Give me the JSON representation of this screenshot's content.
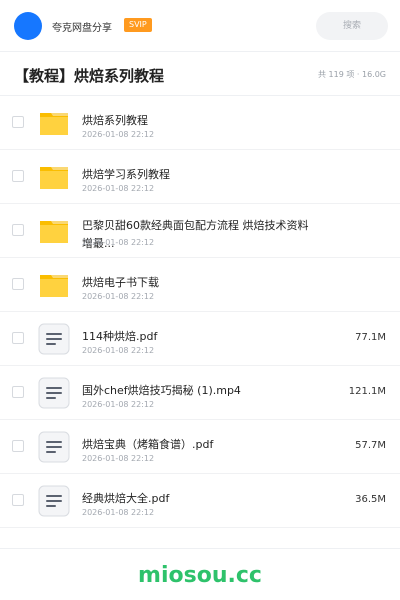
{
  "header": {
    "app_name": "夸克网盘分享",
    "badge": "SVIP",
    "search_placeholder": "搜索"
  },
  "folder": {
    "title": "【教程】烘焙系列教程",
    "stats": "共 119 项 · 16.0G"
  },
  "files": [
    {
      "type": "folder",
      "name": "烘焙系列教程",
      "date": "2026-01-08 22:12",
      "size": ""
    },
    {
      "type": "folder",
      "name": "烘焙学习系列教程",
      "date": "2026-01-08 22:12",
      "size": ""
    },
    {
      "type": "folder",
      "name": "巴黎贝甜60款经典面包配方流程 烘焙技术资料 增最...",
      "date": "2026-01-08 22:12",
      "size": ""
    },
    {
      "type": "folder",
      "name": "烘焙电子书下载",
      "date": "2026-01-08 22:12",
      "size": ""
    },
    {
      "type": "file",
      "name": "114种烘焙.pdf",
      "date": "2026-01-08 22:12",
      "size": "77.1M"
    },
    {
      "type": "file",
      "name": "国外chef烘焙技巧揭秘 (1).mp4",
      "date": "2026-01-08 22:12",
      "size": "121.1M"
    },
    {
      "type": "file",
      "name": "烘焙宝典（烤箱食谱）.pdf",
      "date": "2026-01-08 22:12",
      "size": "57.7M"
    },
    {
      "type": "file",
      "name": "经典烘焙大全.pdf",
      "date": "2026-01-08 22:12",
      "size": "36.5M"
    }
  ],
  "footer": {
    "watermark": "miosou.cc"
  },
  "colors": {
    "accent": "#1677ff",
    "badge": "#ff9a1f",
    "folder": "#ffc400",
    "watermark": "#2ec26b"
  }
}
